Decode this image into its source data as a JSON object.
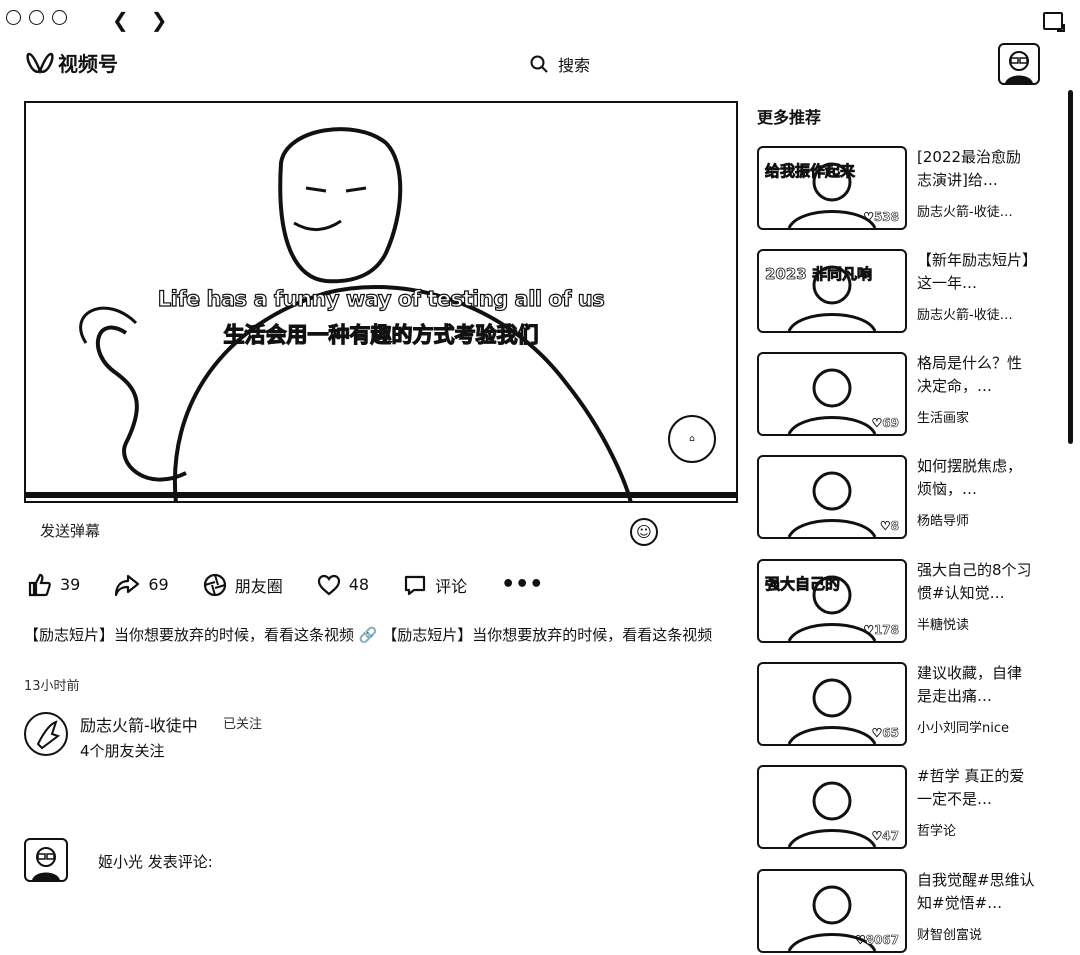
{
  "window": {
    "back_icon": "chevron-left",
    "forward_icon": "chevron-right"
  },
  "header": {
    "logo_text": "视频号",
    "search_label": "搜索"
  },
  "player": {
    "subtitle_en": "Life has a funny way of testing all of us",
    "subtitle_cn": "生活会用一种有趣的方式考验我们"
  },
  "danmaku": {
    "placeholder": "发送弹幕",
    "emoji_icon": "smile-icon"
  },
  "actions": {
    "like_count": "39",
    "forward_count": "69",
    "moments_label": "朋友圈",
    "favorite_count": "48",
    "comment_label": "评论",
    "more_icon": "•••"
  },
  "post": {
    "description": "【励志短片】当你想要放弃的时候，看看这条视频 🔗 【励志短片】当你想要放弃的时候，看看这条视频",
    "time": "13小时前"
  },
  "author": {
    "name": "励志火箭-收徒中",
    "follow_status": "已关注",
    "friends": "4个朋友关注"
  },
  "comment": {
    "prompt": "姬小光 发表评论:"
  },
  "sidebar": {
    "title": "更多推荐",
    "items": [
      {
        "title": "[2022最治愈励志演讲]给…",
        "author": "励志火箭-收徒…",
        "likes": "538",
        "thumb_text": "给我振作起来"
      },
      {
        "title": "【新年励志短片】这一年…",
        "author": "励志火箭-收徒…",
        "likes": "",
        "thumb_text": "2023 非同凡响"
      },
      {
        "title": "格局是什么？性决定命，…",
        "author": "生活画家",
        "likes": "69",
        "thumb_text": ""
      },
      {
        "title": "如何摆脱焦虑，烦恼，…",
        "author": "杨皓导师",
        "likes": "8",
        "thumb_text": ""
      },
      {
        "title": "强大自己的8个习惯#认知觉…",
        "author": "半糖悦读",
        "likes": "178",
        "thumb_text": "强大自己的"
      },
      {
        "title": "建议收藏，自律是走出痛…",
        "author": "小小刘同学nice",
        "likes": "65",
        "thumb_text": ""
      },
      {
        "title": "#哲学 真正的爱一定不是…",
        "author": "哲学论",
        "likes": "47",
        "thumb_text": ""
      },
      {
        "title": "自我觉醒#思维认知#觉悟#…",
        "author": "财智创富说",
        "likes": "8067",
        "thumb_text": ""
      }
    ]
  }
}
